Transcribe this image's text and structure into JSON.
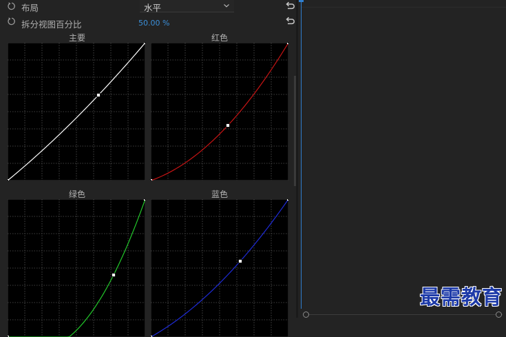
{
  "controls": {
    "layout": {
      "label": "布局",
      "value": "水平"
    },
    "split_percent": {
      "label": "拆分视图百分比",
      "value": "50.00 %"
    }
  },
  "curves": [
    {
      "key": "master",
      "title": "主要",
      "color": "#ffffff",
      "handle": [
        0.66,
        0.62
      ]
    },
    {
      "key": "red",
      "title": "红色",
      "color": "#c81414",
      "handle": [
        0.56,
        0.4
      ]
    },
    {
      "key": "green",
      "title": "绿色",
      "color": "#22c82a",
      "handle": [
        0.77,
        0.45
      ]
    },
    {
      "key": "blue",
      "title": "蓝色",
      "color": "#1e2bd8",
      "handle": [
        0.65,
        0.55
      ]
    }
  ],
  "watermark": "最需教育",
  "icons": {
    "reset": "reset-circle-icon",
    "dropdown": "chevron-down-icon",
    "reset_param": "reset-arrow-icon"
  }
}
